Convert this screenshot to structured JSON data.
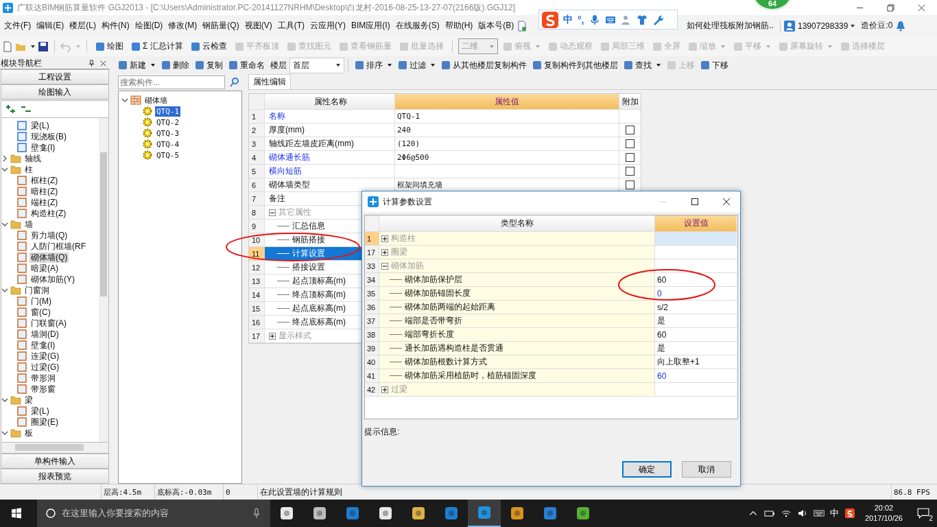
{
  "window": {
    "title": "广联达BIM钢筋算量软件 GGJ2013 - [C:\\Users\\Administrator.PC-20141127NRHM\\Desktop\\白龙村-2016-08-25-13-27-07(2166版).GGJ12]"
  },
  "floating_badge": "64",
  "ime": {
    "mode": "中",
    "punct": "°,"
  },
  "menu": [
    "文件(F)",
    "编辑(E)",
    "楼层(L)",
    "构件(N)",
    "绘图(D)",
    "修改(M)",
    "钢筋量(Q)",
    "视图(V)",
    "工具(T)",
    "云应用(Y)",
    "BIM应用(I)",
    "在线服务(S)",
    "帮助(H)",
    "版本号(B)"
  ],
  "menu_right": {
    "tip": "如何处理筏板附加钢筋..",
    "phone": "13907298339",
    "beans": "造价豆:0"
  },
  "toolbar": {
    "undo": {
      "disabled": true
    },
    "items": [
      {
        "label": "绘图",
        "disabled": false,
        "dropdown": false
      },
      {
        "label": "Σ 汇总计算",
        "disabled": false,
        "dropdown": false
      },
      {
        "label": "云检查",
        "disabled": false,
        "dropdown": false
      },
      {
        "label": "平齐板顶",
        "disabled": true,
        "dropdown": false
      },
      {
        "label": "查找图元",
        "disabled": true,
        "dropdown": false
      },
      {
        "label": "查看钢筋量",
        "disabled": true,
        "dropdown": false
      },
      {
        "label": "批量选择",
        "disabled": true,
        "dropdown": false
      }
    ],
    "view_mode": {
      "value": "二维",
      "disabled": true
    },
    "view_items": [
      {
        "label": "俯视",
        "disabled": true,
        "dropdown": true
      },
      {
        "label": "动态观察",
        "disabled": true,
        "dropdown": false
      },
      {
        "label": "局部三维",
        "disabled": true,
        "dropdown": false
      },
      {
        "label": "全屏",
        "disabled": true,
        "dropdown": false
      },
      {
        "label": "缩放",
        "disabled": true,
        "dropdown": true
      },
      {
        "label": "平移",
        "disabled": true,
        "dropdown": true
      },
      {
        "label": "屏幕旋转",
        "disabled": true,
        "dropdown": true
      },
      {
        "label": "选择楼层",
        "disabled": true,
        "dropdown": false
      }
    ]
  },
  "nav": {
    "title": "模块导航栏",
    "top_buttons": [
      "工程设置",
      "绘图输入"
    ],
    "bottom_buttons": [
      "单构件输入",
      "报表预览"
    ],
    "tree": [
      {
        "label": "梁(L)",
        "kind": "leaf",
        "selected": false
      },
      {
        "label": "现浇板(B)",
        "kind": "leaf",
        "selected": false
      },
      {
        "label": "壁龛(I)",
        "kind": "leaf",
        "selected": false
      },
      {
        "label": "轴线",
        "kind": "folder",
        "expanded": false,
        "selected": false
      },
      {
        "label": "柱",
        "kind": "folder",
        "expanded": true,
        "selected": false,
        "children": [
          {
            "label": "框柱(Z)",
            "kind": "leaf",
            "selected": false
          },
          {
            "label": "暗柱(Z)",
            "kind": "leaf",
            "selected": false
          },
          {
            "label": "端柱(Z)",
            "kind": "leaf",
            "selected": false
          },
          {
            "label": "构造柱(Z)",
            "kind": "leaf",
            "selected": false
          }
        ]
      },
      {
        "label": "墙",
        "kind": "folder",
        "expanded": true,
        "selected": false,
        "children": [
          {
            "label": "剪力墙(Q)",
            "kind": "leaf",
            "selected": false
          },
          {
            "label": "人防门框墙(RF",
            "kind": "leaf",
            "selected": false
          },
          {
            "label": "砌体墙(Q)",
            "kind": "leaf",
            "selected": true
          },
          {
            "label": "暗梁(A)",
            "kind": "leaf",
            "selected": false
          },
          {
            "label": "砌体加筋(Y)",
            "kind": "leaf",
            "selected": false
          }
        ]
      },
      {
        "label": "门窗洞",
        "kind": "folder",
        "expanded": true,
        "selected": false,
        "children": [
          {
            "label": "门(M)",
            "kind": "leaf",
            "selected": false
          },
          {
            "label": "窗(C)",
            "kind": "leaf",
            "selected": false
          },
          {
            "label": "门联窗(A)",
            "kind": "leaf",
            "selected": false
          },
          {
            "label": "墙洞(D)",
            "kind": "leaf",
            "selected": false
          },
          {
            "label": "壁龛(I)",
            "kind": "leaf",
            "selected": false
          },
          {
            "label": "连梁(G)",
            "kind": "leaf",
            "selected": false
          },
          {
            "label": "过梁(G)",
            "kind": "leaf",
            "selected": false
          },
          {
            "label": "带形洞",
            "kind": "leaf",
            "selected": false
          },
          {
            "label": "带形窗",
            "kind": "leaf",
            "selected": false
          }
        ]
      },
      {
        "label": "梁",
        "kind": "folder",
        "expanded": true,
        "selected": false,
        "children": [
          {
            "label": "梁(L)",
            "kind": "leaf",
            "selected": false
          },
          {
            "label": "圈梁(E)",
            "kind": "leaf",
            "selected": false
          }
        ]
      },
      {
        "label": "板",
        "kind": "folder",
        "expanded": true,
        "selected": false
      }
    ]
  },
  "toolbar2": {
    "items": [
      {
        "label": "新建",
        "disabled": false,
        "dropdown": true
      },
      {
        "label": "删除",
        "disabled": false,
        "dropdown": false
      },
      {
        "label": "复制",
        "disabled": false,
        "dropdown": false
      },
      {
        "label": "重命名",
        "disabled": false,
        "dropdown": false
      }
    ],
    "floor_label": "楼层",
    "floor_value": "首层",
    "items2": [
      {
        "label": "排序",
        "disabled": false,
        "dropdown": true
      },
      {
        "label": "过滤",
        "disabled": false,
        "dropdown": true
      },
      {
        "label": "从其他楼层复制构件",
        "disabled": false,
        "dropdown": false
      },
      {
        "label": "复制构件到其他楼层",
        "disabled": false,
        "dropdown": false
      },
      {
        "label": "查找",
        "disabled": false,
        "dropdown": true
      },
      {
        "label": "上移",
        "disabled": true,
        "dropdown": false
      },
      {
        "label": "下移",
        "disabled": false,
        "dropdown": false
      }
    ]
  },
  "components": {
    "search_placeholder": "搜索构件...",
    "tree": [
      {
        "label": "砌体墙",
        "kind": "folder",
        "expanded": true,
        "selected": false,
        "children": [
          {
            "label": "QTQ-1",
            "kind": "leaf",
            "selected": true
          },
          {
            "label": "QTQ-2",
            "kind": "leaf",
            "selected": false
          },
          {
            "label": "QTQ-3",
            "kind": "leaf",
            "selected": false
          },
          {
            "label": "QTQ-4",
            "kind": "leaf",
            "selected": false
          },
          {
            "label": "QTQ-5",
            "kind": "leaf",
            "selected": false
          }
        ]
      }
    ]
  },
  "properties": {
    "tab": "属性编辑",
    "columns": [
      "属性名称",
      "属性值",
      "附加"
    ],
    "rows": [
      {
        "num": "1",
        "name": "名称",
        "value": "QTQ-1",
        "kind": "link",
        "selected": false
      },
      {
        "num": "2",
        "name": "厚度(mm)",
        "value": "240",
        "kind": "field",
        "selected": false,
        "checked": false
      },
      {
        "num": "3",
        "name": "轴线距左墙皮距离(mm)",
        "value": "(120)",
        "kind": "field",
        "selected": false,
        "checked": false
      },
      {
        "num": "4",
        "name": "砌体通长筋",
        "value": "2Φ6@500",
        "kind": "link",
        "selected": false,
        "checked": false
      },
      {
        "num": "5",
        "name": "横向短筋",
        "kind": "link",
        "selected": false,
        "checked": false
      },
      {
        "num": "6",
        "name": "砌体墙类型",
        "value": "框架间填充墙",
        "kind": "field",
        "selected": false,
        "checked": false
      },
      {
        "num": "7",
        "name": "备注",
        "kind": "field",
        "selected": false
      },
      {
        "num": "8",
        "name": "其它属性",
        "kind": "group",
        "expanded": true,
        "selected": false
      },
      {
        "num": "9",
        "name": "汇总信息",
        "kind": "child",
        "selected": false
      },
      {
        "num": "10",
        "name": "钢筋搭接",
        "kind": "child",
        "selected": false
      },
      {
        "num": "11",
        "name": "计算设置",
        "kind": "child",
        "selected": true
      },
      {
        "num": "12",
        "name": "搭接设置",
        "kind": "child",
        "selected": false
      },
      {
        "num": "13",
        "name": "起点顶标高(m)",
        "kind": "child",
        "selected": false
      },
      {
        "num": "14",
        "name": "终点顶标高(m)",
        "kind": "child",
        "selected": false
      },
      {
        "num": "15",
        "name": "起点底标高(m)",
        "kind": "child",
        "selected": false
      },
      {
        "num": "16",
        "name": "终点底标高(m)",
        "kind": "child",
        "selected": false
      },
      {
        "num": "17",
        "name": "显示样式",
        "kind": "group",
        "expanded": false,
        "selected": false
      }
    ]
  },
  "dialog": {
    "title": "计算参数设置",
    "columns": [
      "类型名称",
      "设置值"
    ],
    "rows": [
      {
        "num": "1",
        "name": "构造柱",
        "kind": "group",
        "expanded": false,
        "selected": true
      },
      {
        "num": "17",
        "name": "圈梁",
        "kind": "group",
        "expanded": false,
        "selected": false
      },
      {
        "num": "33",
        "name": "砌体加筋",
        "kind": "group",
        "expanded": true,
        "selected": false
      },
      {
        "num": "34",
        "name": "砌体加筋保护层",
        "value": "60",
        "kind": "item",
        "modified": false,
        "selected": false
      },
      {
        "num": "35",
        "name": "砌体加筋锚固长度",
        "value": "0",
        "kind": "item",
        "modified": true,
        "selected": false
      },
      {
        "num": "36",
        "name": "砌体加筋两端的起始距离",
        "value": "s/2",
        "kind": "item",
        "modified": false,
        "selected": false
      },
      {
        "num": "37",
        "name": "端部是否带弯折",
        "value": "是",
        "kind": "item",
        "modified": false,
        "selected": false
      },
      {
        "num": "38",
        "name": "端部弯折长度",
        "value": "60",
        "kind": "item",
        "modified": false,
        "selected": false
      },
      {
        "num": "39",
        "name": "通长加筋遇构造柱是否贯通",
        "value": "是",
        "kind": "item",
        "modified": false,
        "selected": false
      },
      {
        "num": "40",
        "name": "砌体加筋根数计算方式",
        "value": "向上取整+1",
        "kind": "item",
        "modified": false,
        "selected": false
      },
      {
        "num": "41",
        "name": "砌体加筋采用植筋时，植筋锚固深度",
        "value": "60",
        "kind": "item",
        "modified": true,
        "selected": false
      },
      {
        "num": "42",
        "name": "过梁",
        "kind": "group",
        "expanded": false,
        "selected": false
      }
    ],
    "hint_label": "提示信息:",
    "buttons": [
      {
        "label": "确定",
        "default": true
      },
      {
        "label": "取消",
        "default": false
      }
    ]
  },
  "status_bar": {
    "floor_height": "层高:4.5m",
    "bottom_elevation": "底标高:-0.03m",
    "count": "0",
    "message": "在此设置墙的计算规则",
    "fps": "86.8 FPS"
  },
  "taskbar": {
    "search_placeholder": "在这里输入你要搜索的内容",
    "apps": [
      {
        "selected": false
      },
      {
        "selected": false
      },
      {
        "selected": false
      },
      {
        "selected": false
      },
      {
        "selected": false
      },
      {
        "selected": false
      },
      {
        "selected": true
      },
      {
        "selected": false
      },
      {
        "selected": false
      },
      {
        "selected": false
      }
    ],
    "ime": "中",
    "time": "20:02",
    "date": "2017/10/26",
    "notifications": "2"
  }
}
